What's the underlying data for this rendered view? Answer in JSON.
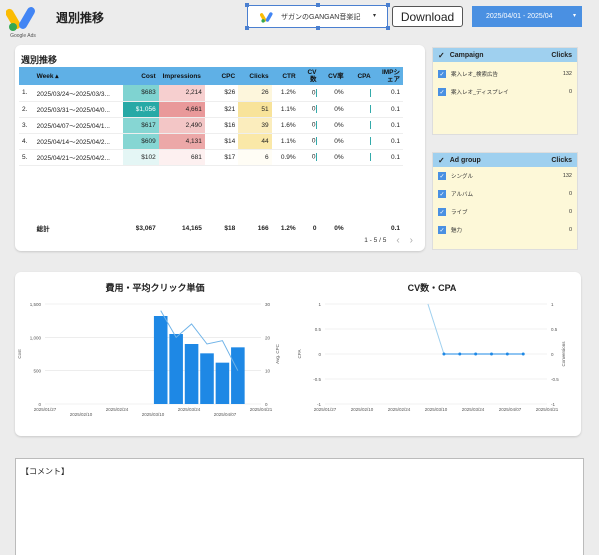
{
  "header": {
    "title": "週別推移",
    "logo_text": "Google Ads",
    "account_label": "ザガンのGANGAN音楽記",
    "download_label": "Download",
    "date_range": "2025/04/01 - 2025/04"
  },
  "table": {
    "title": "週別推移",
    "columns": [
      "Week ▴",
      "Cost",
      "Impressions",
      "CPC",
      "Clicks",
      "CTR",
      "CV数",
      "CV率",
      "CPA",
      "IMPシェア"
    ],
    "rows": [
      {
        "idx": "1.",
        "week": "2025/03/24〜2025/03/3...",
        "cost": "$683",
        "imp": "2,214",
        "cpc": "$26",
        "clicks": "26",
        "ctr": "1.2%",
        "cv": "0",
        "cvr": "0%",
        "imps": "0.1",
        "costColor": "#7fd3d1",
        "impColor": "#f6cfcf",
        "clickColor": "#fdf6dc"
      },
      {
        "idx": "2.",
        "week": "2025/03/31〜2025/04/0...",
        "cost": "$1,056",
        "imp": "4,661",
        "cpc": "$21",
        "clicks": "51",
        "ctr": "1.1%",
        "cv": "0",
        "cvr": "0%",
        "imps": "0.1",
        "costColor": "#27a9a6",
        "impColor": "#e9999a",
        "clickColor": "#f8e39a"
      },
      {
        "idx": "3.",
        "week": "2025/04/07〜2025/04/1...",
        "cost": "$617",
        "imp": "2,490",
        "cpc": "$16",
        "clicks": "39",
        "ctr": "1.6%",
        "cv": "0",
        "cvr": "0%",
        "imps": "0.1",
        "costColor": "#86d6d3",
        "impColor": "#f3c6c6",
        "clickColor": "#fbedbd"
      },
      {
        "idx": "4.",
        "week": "2025/04/14〜2025/04/2...",
        "cost": "$609",
        "imp": "4,131",
        "cpc": "$14",
        "clicks": "44",
        "ctr": "1.1%",
        "cv": "0",
        "cvr": "0%",
        "imps": "0.1",
        "costColor": "#86d6d3",
        "impColor": "#eca8a8",
        "clickColor": "#fae8a8"
      },
      {
        "idx": "5.",
        "week": "2025/04/21〜2025/04/2...",
        "cost": "$102",
        "imp": "681",
        "cpc": "$17",
        "clicks": "6",
        "ctr": "0.9%",
        "cv": "0",
        "cvr": "0%",
        "imps": "0.1",
        "costColor": "#e4f6f5",
        "impColor": "#fdf0f0",
        "clickColor": "#fffdf5"
      }
    ],
    "total": {
      "label": "総計",
      "cost": "$3,067",
      "imp": "14,165",
      "cpc": "$18",
      "clicks": "166",
      "ctr": "1.2%",
      "cv": "0",
      "cvr": "0%",
      "imps": "0.1"
    },
    "pager": "1 - 5 / 5"
  },
  "campaign_panel": {
    "title": "Campaign",
    "metric": "Clicks",
    "items": [
      {
        "name": "案入レオ_検索広告",
        "value": "132"
      },
      {
        "name": "案入レオ_ディスプレイ",
        "value": "0"
      }
    ]
  },
  "adgroup_panel": {
    "title": "Ad group",
    "metric": "Clicks",
    "items": [
      {
        "name": "シングル",
        "value": "132"
      },
      {
        "name": "アルバム",
        "value": "0"
      },
      {
        "name": "ライブ",
        "value": "0"
      },
      {
        "name": "魅力",
        "value": "0"
      }
    ]
  },
  "comment_label": "【コメント】",
  "chart_data": [
    {
      "type": "bar",
      "title": "費用・平均クリック単価",
      "ylabel": "Cost",
      "y2label": "Avg. CPC",
      "x": [
        "2025/01/27",
        "2025/02/10",
        "2025/02/24",
        "2025/03/10",
        "2025/03/24",
        "2025/04/07",
        "2025/04/21"
      ],
      "ylim": [
        0,
        1500
      ],
      "y2lim": [
        0,
        30
      ],
      "yticks": [
        "1,500",
        "1,000",
        "500",
        "0"
      ],
      "y2ticks": [
        "30",
        "20",
        "10",
        "0"
      ],
      "series": [
        {
          "name": "Cost",
          "values": [
            0,
            0,
            0,
            0,
            0,
            0,
            0,
            1320,
            1050,
            900,
            760,
            620,
            850,
            0
          ]
        },
        {
          "name": "Avg. CPC",
          "values": [
            null,
            null,
            null,
            null,
            null,
            null,
            null,
            28,
            20,
            24,
            18,
            19,
            10,
            null
          ]
        }
      ]
    },
    {
      "type": "line",
      "title": "CV数・CPA",
      "ylabel": "CPA",
      "y2label": "Conversions",
      "x": [
        "2025/01/27",
        "2025/02/10",
        "2025/02/24",
        "2025/03/10",
        "2025/03/24",
        "2025/04/07",
        "2025/04/21"
      ],
      "ylim": [
        -1,
        1
      ],
      "y2lim": [
        -1,
        1
      ],
      "yticks": [
        "1",
        "0.5",
        "0",
        "-0.5",
        "-1"
      ],
      "y2ticks": [
        "1",
        "0.5",
        "0",
        "-0.5",
        "-1"
      ],
      "series": [
        {
          "name": "Conversions",
          "values": [
            null,
            null,
            null,
            null,
            null,
            null,
            null,
            0,
            0,
            0,
            0,
            0,
            0,
            null
          ]
        }
      ]
    }
  ]
}
